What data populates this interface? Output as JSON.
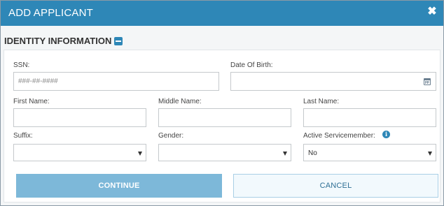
{
  "dialog": {
    "title": "ADD APPLICANT",
    "close_glyph": "✖"
  },
  "section": {
    "title": "IDENTITY INFORMATION",
    "toggle_icon": "minus-square-icon"
  },
  "fields": {
    "ssn": {
      "label": "SSN:",
      "placeholder": "###-##-####",
      "value": ""
    },
    "dob": {
      "label": "Date Of Birth:",
      "value": "",
      "icon": "calendar-icon"
    },
    "first_name": {
      "label": "First Name:",
      "value": ""
    },
    "middle_name": {
      "label": "Middle Name:",
      "value": ""
    },
    "last_name": {
      "label": "Last Name:",
      "value": ""
    },
    "suffix": {
      "label": "Suffix:",
      "value": ""
    },
    "gender": {
      "label": "Gender:",
      "value": ""
    },
    "servicemember": {
      "label": "Active Servicemember:",
      "value": "No",
      "info_icon": "info-circle-icon",
      "info_glyph": "i"
    }
  },
  "buttons": {
    "continue": "CONTINUE",
    "cancel": "CANCEL"
  },
  "colors": {
    "header": "#2e87b7",
    "continue_bg": "#7db8d9",
    "cancel_bg": "#f2f9fd"
  }
}
